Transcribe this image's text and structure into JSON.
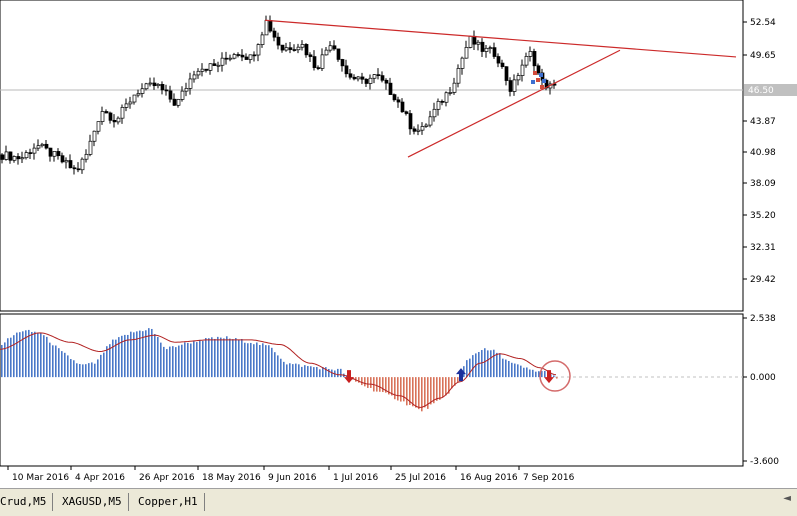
{
  "colors": {
    "trendline": "#cc2a2a",
    "candle": "#000000",
    "hist_positive": "#4a78c8",
    "hist_negative": "#d8735a",
    "signal_line": "#b22222",
    "arrow_up": "#1a2f9c",
    "arrow_down": "#c82020",
    "circle": "#d46b6b",
    "current_price_line": "#b8b8b8",
    "current_price_label_bg": "#c0c0c0"
  },
  "chart_data": [
    {
      "type": "candlestick",
      "title": "",
      "yticks": [
        "52.54",
        "49.65",
        "46.50",
        "43.87",
        "40.98",
        "38.09",
        "35.20",
        "32.31",
        "29.42"
      ],
      "ylim": [
        27.0,
        53.7
      ],
      "current_price": "46.50",
      "xlabels": [
        "10 Mar 2016",
        "4 Apr 2016",
        "26 Apr 2016",
        "18 May 2016",
        "9 Jun 2016",
        "1 Jul 2016",
        "25 Jul 2016",
        "16 Aug 2016",
        "7 Sep 2016"
      ],
      "grid": false,
      "annotations": {
        "resistance_line": {
          "from": [
            265,
            52.6
          ],
          "to": [
            736,
            49.3
          ]
        },
        "support_line": {
          "from": [
            408,
            40.3
          ],
          "to": [
            620,
            49.9
          ]
        }
      }
    },
    {
      "type": "histogram+line",
      "title": "",
      "yticks": [
        "2.538",
        "0.000",
        "-3.600"
      ],
      "ylim": [
        -3.6,
        2.538
      ],
      "zero_line": 0.0,
      "signals": [
        {
          "type": "sell",
          "x": 349
        },
        {
          "type": "buy",
          "x": 461
        },
        {
          "type": "sell",
          "x": 549
        }
      ],
      "highlight_circle_x": 555
    }
  ],
  "tabs": [
    "Crud,M5",
    "XAGUSD,M5",
    "Copper,H1"
  ]
}
